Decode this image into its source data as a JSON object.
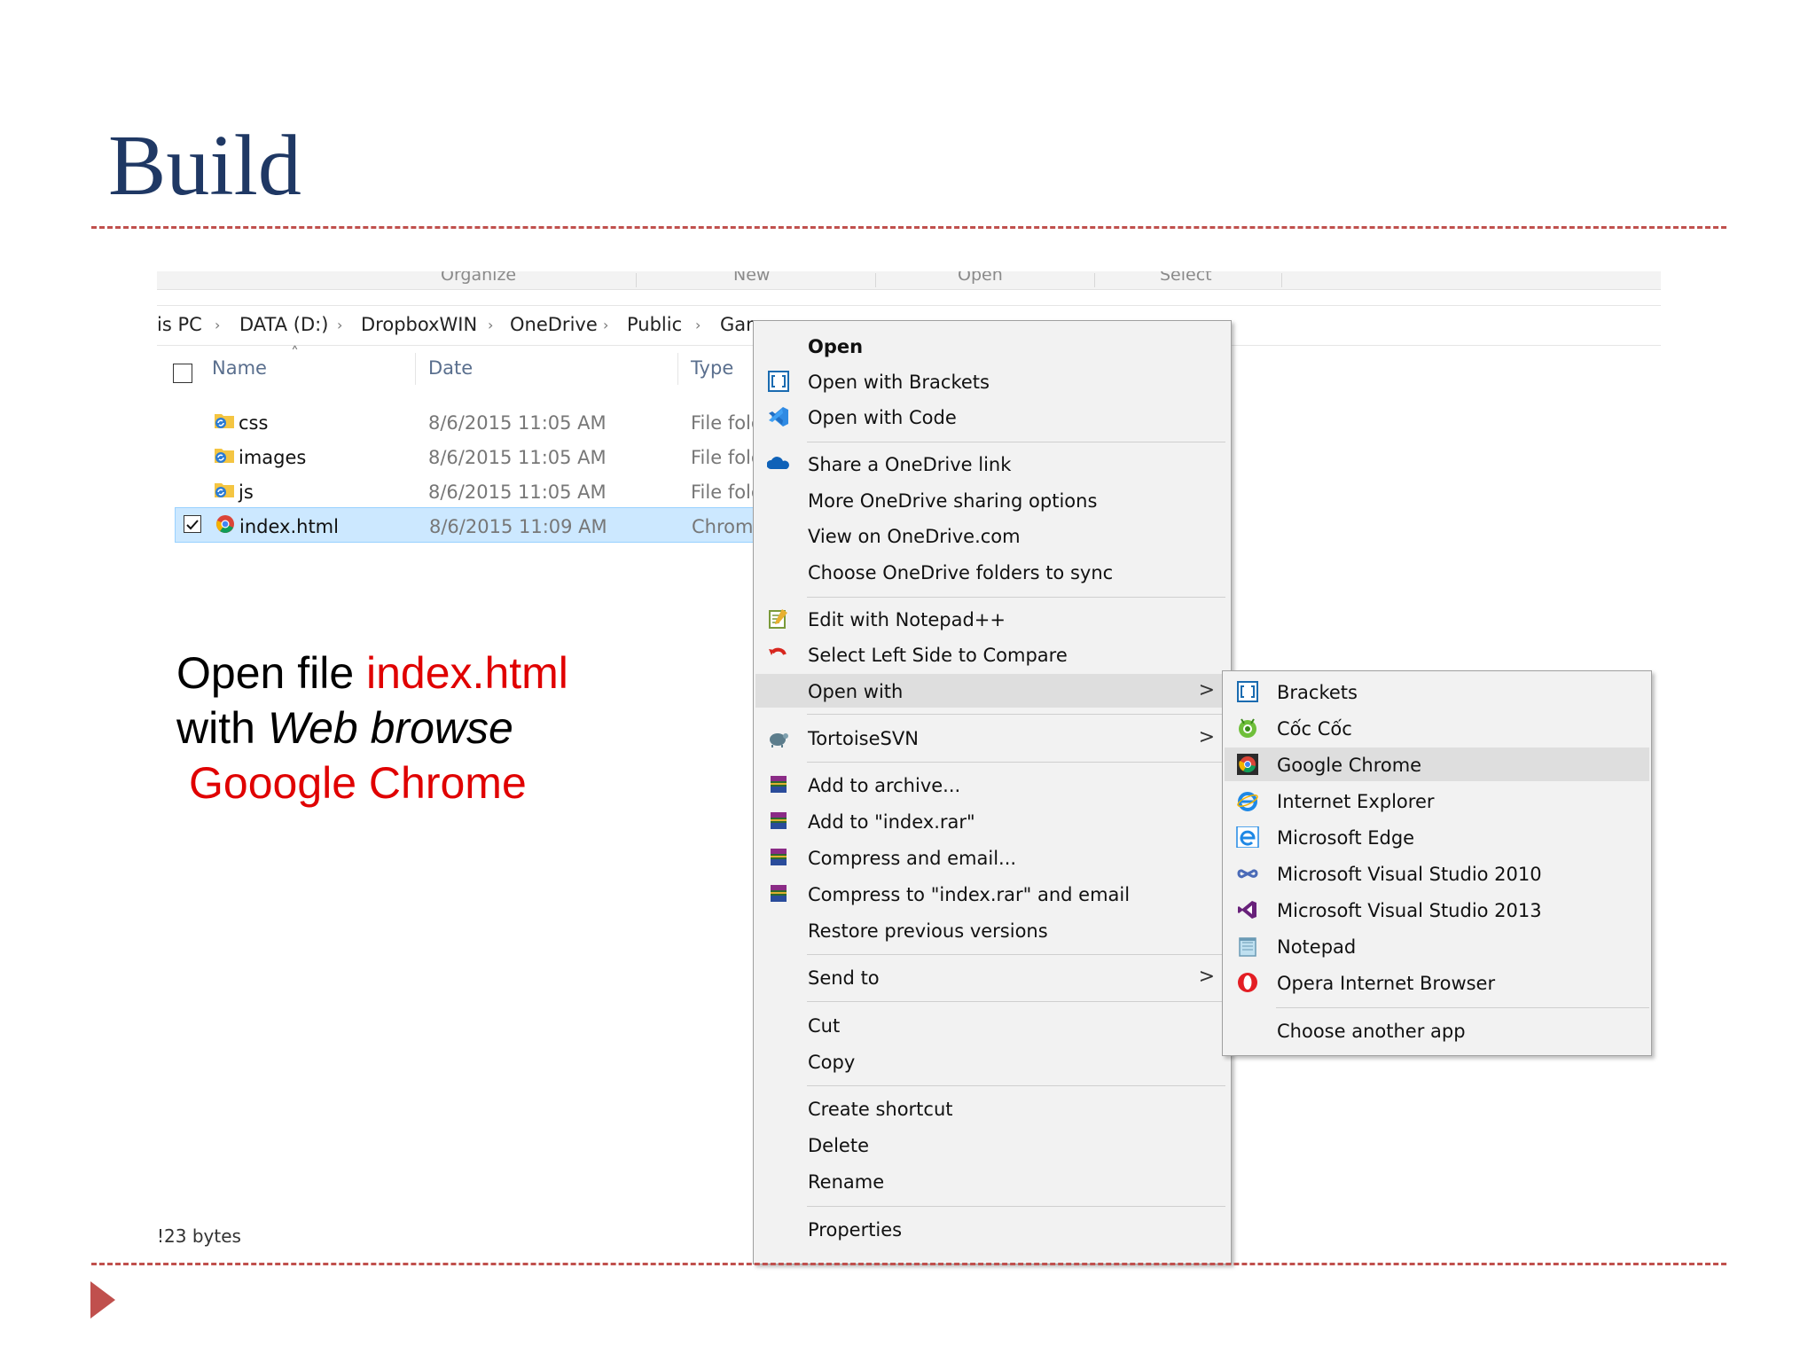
{
  "slide": {
    "title": "Build",
    "text_line1_prefix": "Open file ",
    "text_line1_highlight": "index.html",
    "text_line2_prefix": "with ",
    "text_line2_italic": "Web browse",
    "text_line3": "Gooogle Chrome"
  },
  "explorer": {
    "ribbon": [
      "Organize",
      "New",
      "Open",
      "Select"
    ],
    "breadcrumb": [
      "is PC",
      "DATA (D:)",
      "DropboxWIN",
      "OneDrive",
      "Public",
      "Gan"
    ],
    "columns": {
      "name": "Name",
      "date": "Date",
      "type": "Type"
    },
    "rows": [
      {
        "name": "css",
        "date": "8/6/2015 11:05 AM",
        "type": "File fold"
      },
      {
        "name": "images",
        "date": "8/6/2015 11:05 AM",
        "type": "File fold"
      },
      {
        "name": "js",
        "date": "8/6/2015 11:05 AM",
        "type": "File fold"
      },
      {
        "name": "index.html",
        "date": "8/6/2015 11:09 AM",
        "type": "Chrom"
      }
    ],
    "status": "!23 bytes"
  },
  "context_menu": {
    "items": [
      {
        "label": "Open",
        "icon": "none"
      },
      {
        "label": "Open with Brackets",
        "icon": "brackets-icon"
      },
      {
        "label": "Open with Code",
        "icon": "vscode-icon"
      },
      {
        "label": "Share a OneDrive link",
        "icon": "onedrive-icon"
      },
      {
        "label": "More OneDrive sharing options",
        "icon": "none"
      },
      {
        "label": "View on OneDrive.com",
        "icon": "none"
      },
      {
        "label": "Choose OneDrive folders to sync",
        "icon": "none"
      },
      {
        "label": "Edit with Notepad++",
        "icon": "notepadpp-icon"
      },
      {
        "label": "Select Left Side to Compare",
        "icon": "compare-icon"
      },
      {
        "label": "Open with",
        "icon": "none"
      },
      {
        "label": "TortoiseSVN",
        "icon": "tortoisesvn-icon"
      },
      {
        "label": "Add to archive...",
        "icon": "winrar-icon"
      },
      {
        "label": "Add to \"index.rar\"",
        "icon": "winrar-icon"
      },
      {
        "label": "Compress and email...",
        "icon": "winrar-icon"
      },
      {
        "label": "Compress to \"index.rar\" and email",
        "icon": "winrar-icon"
      },
      {
        "label": "Restore previous versions",
        "icon": "none"
      },
      {
        "label": "Send to",
        "icon": "none"
      },
      {
        "label": "Cut",
        "icon": "none"
      },
      {
        "label": "Copy",
        "icon": "none"
      },
      {
        "label": "Create shortcut",
        "icon": "none"
      },
      {
        "label": "Delete",
        "icon": "none"
      },
      {
        "label": "Rename",
        "icon": "none"
      },
      {
        "label": "Properties",
        "icon": "none"
      }
    ]
  },
  "open_with_menu": {
    "items": [
      {
        "label": "Brackets",
        "icon": "brackets-icon"
      },
      {
        "label": "Cốc Cốc",
        "icon": "coccoc-icon"
      },
      {
        "label": "Google Chrome",
        "icon": "chrome-icon"
      },
      {
        "label": "Internet Explorer",
        "icon": "ie-icon"
      },
      {
        "label": "Microsoft Edge",
        "icon": "edge-icon"
      },
      {
        "label": "Microsoft Visual Studio 2010",
        "icon": "vs2010-icon"
      },
      {
        "label": "Microsoft Visual Studio 2013",
        "icon": "vs2013-icon"
      },
      {
        "label": "Notepad",
        "icon": "notepad-icon"
      },
      {
        "label": "Opera Internet Browser",
        "icon": "opera-icon"
      },
      {
        "label": "Choose another app",
        "icon": "none"
      }
    ]
  },
  "colors": {
    "title": "#1f3864",
    "accent": "#c0504d",
    "highlight_text": "#e00000",
    "selection": "#cce8ff"
  }
}
